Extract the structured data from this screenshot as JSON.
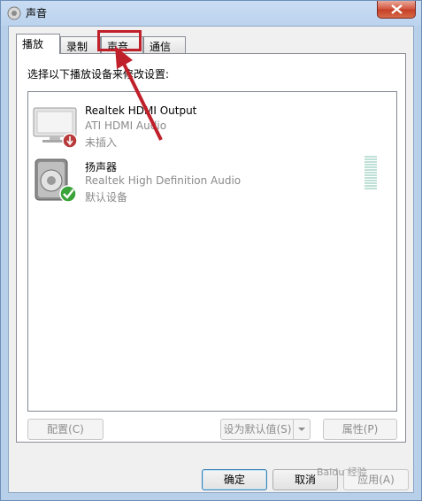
{
  "window": {
    "title": "声音",
    "close_label": "✕"
  },
  "tabs": [
    {
      "label": "播放",
      "active": true
    },
    {
      "label": "录制",
      "active": false
    },
    {
      "label": "声音",
      "active": false
    },
    {
      "label": "通信",
      "active": false
    }
  ],
  "panel": {
    "instruction": "选择以下播放设备来修改设置:"
  },
  "devices": [
    {
      "name": "Realtek HDMI Output",
      "description": "ATI HDMI Audio",
      "status": "未插入",
      "icon": "monitor-icon",
      "badge": "unplugged-icon"
    },
    {
      "name": "扬声器",
      "description": "Realtek High Definition Audio",
      "status": "默认设备",
      "icon": "speaker-icon",
      "badge": "default-checkmark-icon"
    }
  ],
  "buttons": {
    "configure": "配置(C)",
    "set_default": "设为默认值(S)",
    "properties": "属性(P)",
    "ok": "确定",
    "cancel": "取消",
    "apply": "应用(A)"
  },
  "watermark": "Baidu 经验",
  "colors": {
    "annotation": "#c0202a",
    "window_frame": "#b7cfe9",
    "accent": "#3c7fb1"
  }
}
